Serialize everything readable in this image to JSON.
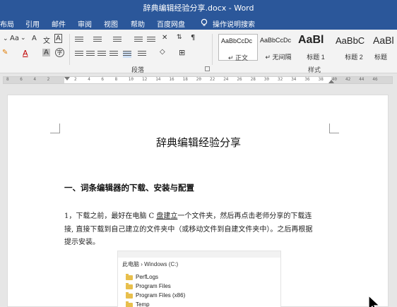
{
  "window": {
    "title": "辞典编辑经验分享.docx  -  Word"
  },
  "tabs": [
    {
      "label": "布局"
    },
    {
      "label": "引用"
    },
    {
      "label": "邮件"
    },
    {
      "label": "审阅"
    },
    {
      "label": "视图"
    },
    {
      "label": "帮助"
    },
    {
      "label": "百度网盘"
    }
  ],
  "tell_me": {
    "icon": "lightbulb-icon",
    "label": "操作说明搜索"
  },
  "ribbon": {
    "font_size_label": "Aa",
    "wen_label": "文",
    "A_label": "A",
    "paragraph_group_label": "段落",
    "styles_group_label": "样式",
    "styles": [
      {
        "preview": "AaBbCcDc",
        "name": "↵ 正文"
      },
      {
        "preview": "AaBbCcDc",
        "name": "↵ 无间隔"
      },
      {
        "preview": "AaBl",
        "name": "标题 1"
      },
      {
        "preview": "AaBbC",
        "name": "标题 2"
      },
      {
        "preview": "AaBl",
        "name": "标题"
      }
    ]
  },
  "ruler": {
    "ticks": [
      "8",
      "6",
      "4",
      "2",
      "",
      "2",
      "4",
      "6",
      "8",
      "10",
      "12",
      "14",
      "16",
      "18",
      "20",
      "22",
      "24",
      "26",
      "28",
      "30",
      "32",
      "34",
      "36",
      "38",
      "40",
      "42",
      "44",
      "46"
    ]
  },
  "document": {
    "title": "辞典编辑经验分享",
    "heading": "一、词条编辑器的下载、安装与配置",
    "para_line1_a": "1，下载之前，最好在电脑 C ",
    "para_line1_u": "盘建立",
    "para_line1_b": "一个文件夹，然后再点击老师分享的下载连",
    "para_line2": "接, 直接下载到自己建立的文件夹中（或移动文件到自建文件夹中）。之后再根据",
    "para_line3": "提示安装。"
  },
  "screenshot": {
    "breadcrumb": "此电脑  ›  Windows (C:)",
    "folders": [
      "PerfLogs",
      "Program Files",
      "Program Files (x86)",
      "Temp"
    ]
  },
  "colors": {
    "word_blue": "#2b579a",
    "ribbon_bg": "#f3f3f3",
    "canvas_bg": "#e6e6e6"
  }
}
